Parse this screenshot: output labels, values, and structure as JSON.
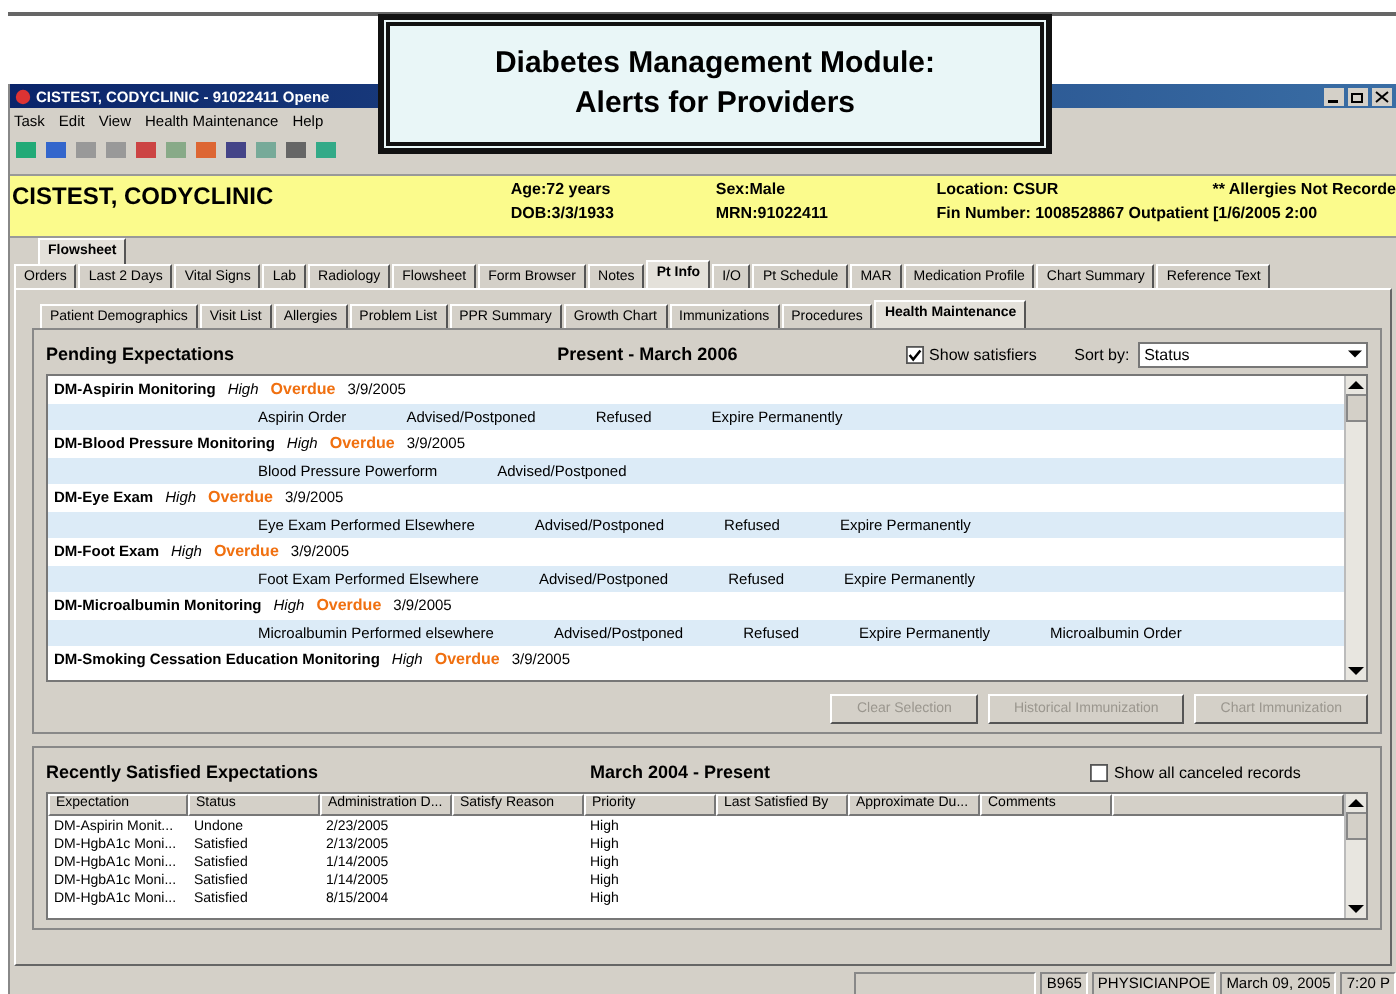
{
  "callout": {
    "lines": [
      "Diabetes Management Module:",
      "Alerts for Providers"
    ]
  },
  "window": {
    "title": "CISTEST, CODYCLINIC - 91022411 Opene"
  },
  "menu": [
    "Task",
    "Edit",
    "View",
    "Health Maintenance",
    "Help"
  ],
  "banner": {
    "name": "CISTEST, CODYCLINIC",
    "col1": [
      "Age:72 years",
      "DOB:3/3/1933"
    ],
    "col2": [
      "Sex:Male",
      "MRN:91022411"
    ],
    "col3": [
      "Location: CSUR",
      "Fin Number: 1008528867 Outpatient [1/6/2005 2:00"
    ],
    "alert": "** Allergies Not Recorde"
  },
  "view_tabs": [
    {
      "label": "Flowsheet",
      "selected": true
    }
  ],
  "tabs": [
    {
      "label": "Orders",
      "selected": false
    },
    {
      "label": "Last 2 Days",
      "selected": false
    },
    {
      "label": "Vital Signs",
      "selected": false
    },
    {
      "label": "Lab",
      "selected": false
    },
    {
      "label": "Radiology",
      "selected": false
    },
    {
      "label": "Flowsheet",
      "selected": false
    },
    {
      "label": "Form Browser",
      "selected": false
    },
    {
      "label": "Notes",
      "selected": false
    },
    {
      "label": "Pt Info",
      "selected": true
    },
    {
      "label": "I/O",
      "selected": false
    },
    {
      "label": "Pt Schedule",
      "selected": false
    },
    {
      "label": "MAR",
      "selected": false
    },
    {
      "label": "Medication Profile",
      "selected": false
    },
    {
      "label": "Chart Summary",
      "selected": false
    },
    {
      "label": "Reference Text",
      "selected": false
    }
  ],
  "sub_tabs": [
    {
      "label": "Patient Demographics",
      "selected": false
    },
    {
      "label": "Visit List",
      "selected": false
    },
    {
      "label": "Allergies",
      "selected": false
    },
    {
      "label": "Problem List",
      "selected": false
    },
    {
      "label": "PPR Summary",
      "selected": false
    },
    {
      "label": "Growth Chart",
      "selected": false
    },
    {
      "label": "Immunizations",
      "selected": false
    },
    {
      "label": "Procedures",
      "selected": false
    },
    {
      "label": "Health Maintenance",
      "selected": true
    }
  ],
  "pending": {
    "title": "Pending Expectations",
    "range": "Present - March 2006",
    "show_satisfiers": {
      "label": "Show satisfiers",
      "checked": true
    },
    "sort_label": "Sort by:",
    "sort_value": "Status",
    "items": [
      {
        "name": "DM-Aspirin Monitoring",
        "priority": "High",
        "status": "Overdue",
        "date": "3/9/2005",
        "actions": [
          "Aspirin Order",
          "Advised/Postponed",
          "Refused",
          "Expire Permanently"
        ]
      },
      {
        "name": "DM-Blood Pressure Monitoring",
        "priority": "High",
        "status": "Overdue",
        "date": "3/9/2005",
        "actions": [
          "Blood Pressure Powerform",
          "Advised/Postponed"
        ]
      },
      {
        "name": "DM-Eye Exam",
        "priority": "High",
        "status": "Overdue",
        "date": "3/9/2005",
        "actions": [
          "Eye Exam Performed Elsewhere",
          "Advised/Postponed",
          "Refused",
          "Expire Permanently"
        ]
      },
      {
        "name": "DM-Foot Exam",
        "priority": "High",
        "status": "Overdue",
        "date": "3/9/2005",
        "actions": [
          "Foot Exam Performed Elsewhere",
          "Advised/Postponed",
          "Refused",
          "Expire Permanently"
        ]
      },
      {
        "name": "DM-Microalbumin Monitoring",
        "priority": "High",
        "status": "Overdue",
        "date": "3/9/2005",
        "actions": [
          "Microalbumin Performed elsewhere",
          "Advised/Postponed",
          "Refused",
          "Expire Permanently",
          "Microalbumin Order"
        ]
      },
      {
        "name": "DM-Smoking Cessation Education Monitoring",
        "priority": "High",
        "status": "Overdue",
        "date": "3/9/2005"
      }
    ]
  },
  "buttons": [
    {
      "label": "Clear Selection",
      "disabled": true
    },
    {
      "label": "Historical Immunization",
      "disabled": true
    },
    {
      "label": "Chart Immunization",
      "disabled": true
    }
  ],
  "satisfied": {
    "title": "Recently Satisfied Expectations",
    "range": "March 2004 - Present",
    "show_canceled": {
      "label": "Show all canceled records",
      "checked": false
    },
    "columns": [
      "Expectation",
      "Status",
      "Administration D...",
      "Satisfy Reason",
      "Priority",
      "Last Satisfied By",
      "Approximate Du...",
      "Comments"
    ],
    "rows": [
      [
        "DM-Aspirin Monit...",
        "Undone",
        "2/23/2005",
        "",
        "High",
        "",
        "",
        ""
      ],
      [
        "DM-HgbA1c Moni...",
        "Satisfied",
        "2/13/2005",
        "",
        "High",
        "",
        "",
        ""
      ],
      [
        "DM-HgbA1c Moni...",
        "Satisfied",
        "1/14/2005",
        "",
        "High",
        "",
        "",
        ""
      ],
      [
        "DM-HgbA1c Moni...",
        "Satisfied",
        "1/14/2005",
        "",
        "High",
        "",
        "",
        ""
      ],
      [
        "DM-HgbA1c Moni...",
        "Satisfied",
        "8/15/2004",
        "",
        "High",
        "",
        "",
        ""
      ]
    ]
  },
  "status_bar": [
    "B965",
    "PHYSICIANPOE",
    "March 09, 2005",
    "7:20 P"
  ]
}
